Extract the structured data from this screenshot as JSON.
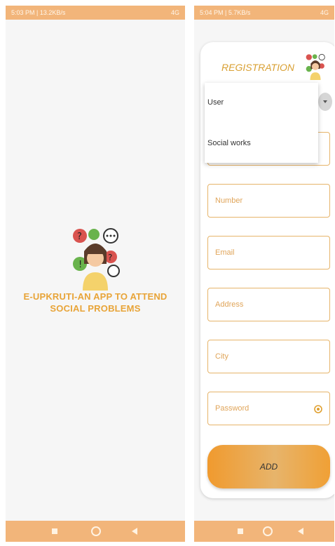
{
  "left_screen": {
    "status_bar": {
      "time": "5:03 PM | 13.2KB/s",
      "right": "4G"
    },
    "title": "E-UPKRUTI-AN APP TO ATTEND SOCIAL PROBLEMS"
  },
  "right_screen": {
    "status_bar": {
      "time": "5:04 PM | 5.7KB/s",
      "right": "4G"
    },
    "title": "REGISTRATION",
    "dropdown_options": [
      "User",
      "Social works"
    ],
    "fields": {
      "number": "Number",
      "email": "Email",
      "address": "Address",
      "city": "City",
      "password": "Password"
    },
    "add_label": "ADD"
  },
  "colors": {
    "accent": "#f2b57a",
    "title": "#e8a438",
    "button": "#f09a2e"
  }
}
